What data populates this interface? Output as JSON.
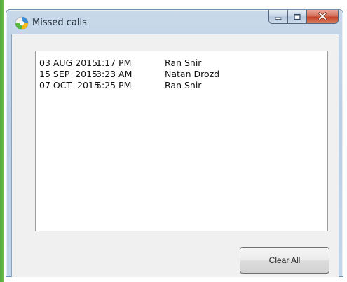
{
  "window": {
    "title": "Missed calls"
  },
  "missed_calls": [
    {
      "date": "03 AUG 2015",
      "time": "1:17 PM",
      "name": "Ran Snir"
    },
    {
      "date": "15 SEP  2015",
      "time": "3:23 AM",
      "name": "Natan Drozd"
    },
    {
      "date": "07 OCT  2015",
      "time": "5:25 PM",
      "name": "Ran Snir"
    }
  ],
  "buttons": {
    "clear_all": "Clear All"
  },
  "icons": {
    "app": "app-logo-icon",
    "minimize": "minimize-icon",
    "maximize": "maximize-icon",
    "close": "close-icon"
  },
  "colors": {
    "close_button": "#c34128",
    "window_frame": "#b9cde3"
  }
}
